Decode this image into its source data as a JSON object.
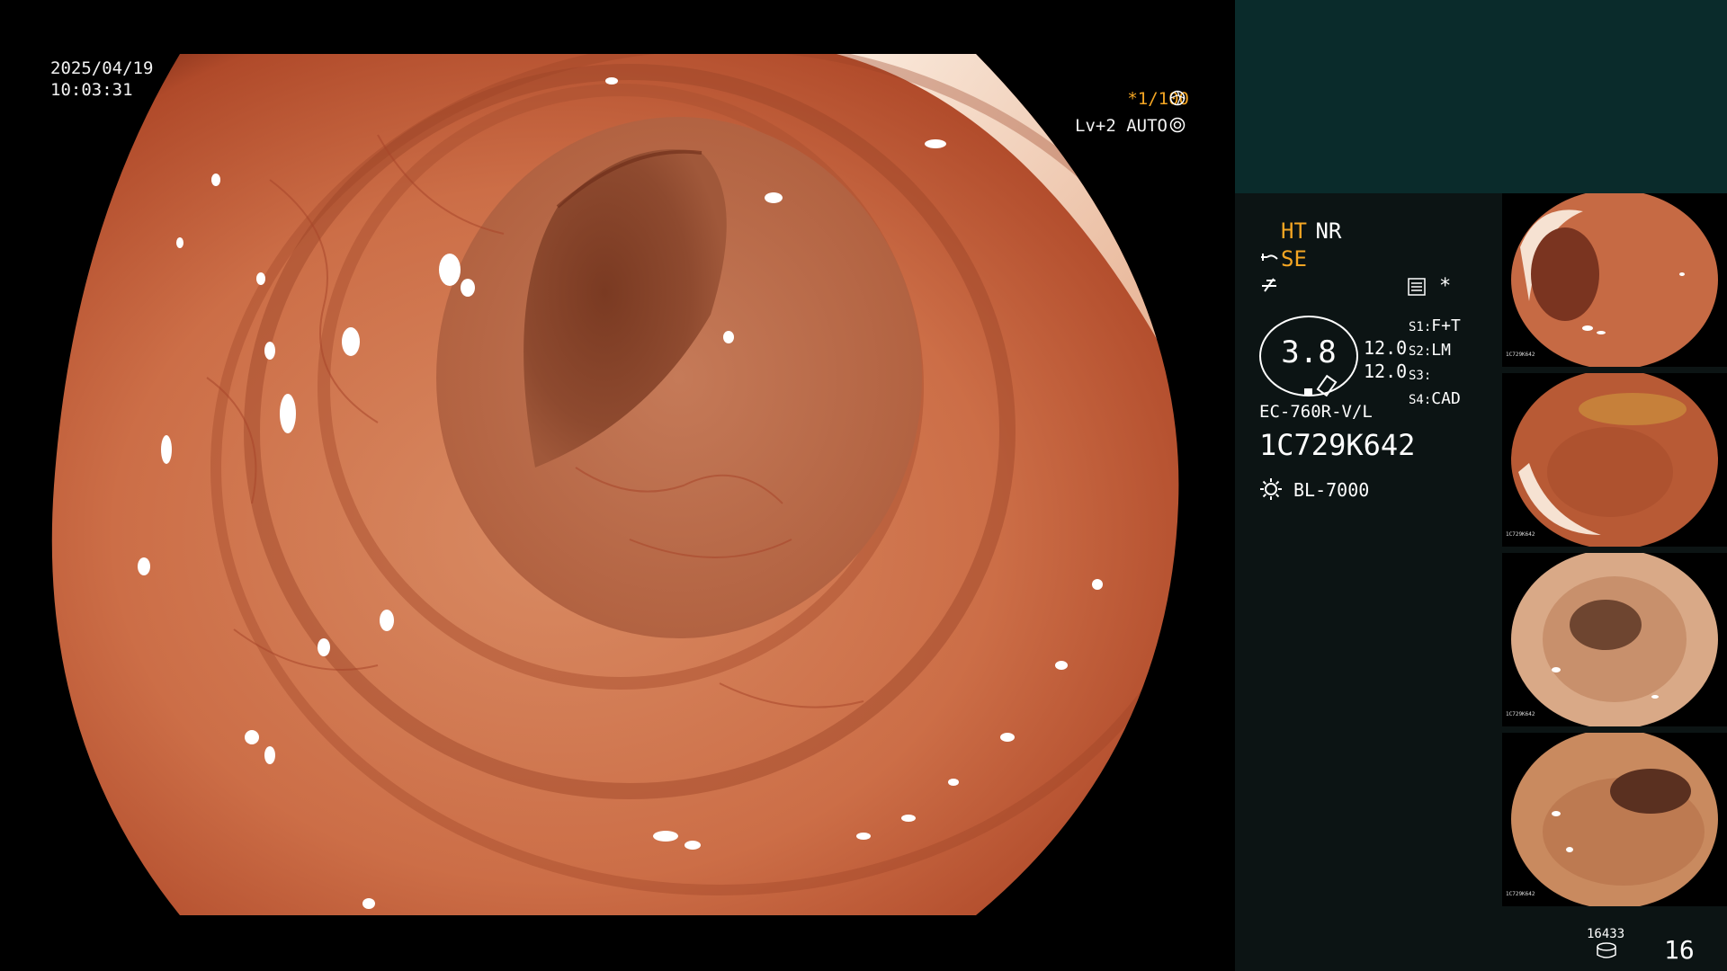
{
  "overlay": {
    "date": "2025/04/19",
    "time": "10:03:31",
    "shutter": "*1/100",
    "exposure": "Lv+2 AUTO"
  },
  "modes": {
    "ht": "HT",
    "nr": "NR",
    "se": "SE"
  },
  "settings": {
    "gauge_value": "3.8",
    "val1": "12.0",
    "val2": "12.0",
    "s1_key": "S1:",
    "s1_val": "F+T",
    "s2_key": "S2:",
    "s2_val": "LM",
    "s3_key": "S3:",
    "s3_val": "",
    "s4_key": "S4:",
    "s4_val": "CAD"
  },
  "device": {
    "scope_model": "EC-760R-V/L",
    "serial": "1C729K642",
    "light_source": "BL-7000"
  },
  "thumbnails": [
    {
      "label": "1C729K642"
    },
    {
      "label": "1C729K642"
    },
    {
      "label": "1C729K642"
    },
    {
      "label": "1C729K642"
    }
  ],
  "footer": {
    "storage_count": "16433",
    "image_count": "16"
  },
  "colors": {
    "accent": "#f5a623",
    "panel_top": "#0a2b2b",
    "panel": "#0c1414",
    "mucosa": "#c8613d"
  },
  "icons": [
    "aperture-icon",
    "auto-exposure-icon",
    "scope-icon",
    "waveform-icon",
    "menu-icon",
    "asterisk-icon",
    "light-icon",
    "storage-icon"
  ]
}
